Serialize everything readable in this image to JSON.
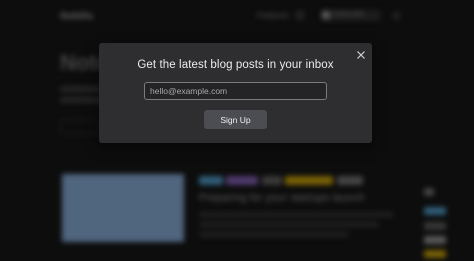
{
  "background": {
    "site_name": "Nobilis",
    "nav": {
      "features_label": "Features",
      "subscribe_label": "Subscribe"
    },
    "hero": {
      "title": "Notes"
    },
    "post": {
      "title": "Preparing for your startups launch",
      "tag_colors": [
        "#4a90b8",
        "#7a5aa8",
        "#5a5a5a",
        "#b8960a",
        "#6a6a6a"
      ],
      "thumbnail_color": "#7b9bc2"
    },
    "side_colors": [
      "#6a6a6a",
      "#4a90b8",
      "#8a8a8a",
      "#b8960a"
    ]
  },
  "modal": {
    "title": "Get the latest blog posts in your inbox",
    "email_placeholder": "hello@example.com",
    "signup_label": "Sign Up"
  }
}
